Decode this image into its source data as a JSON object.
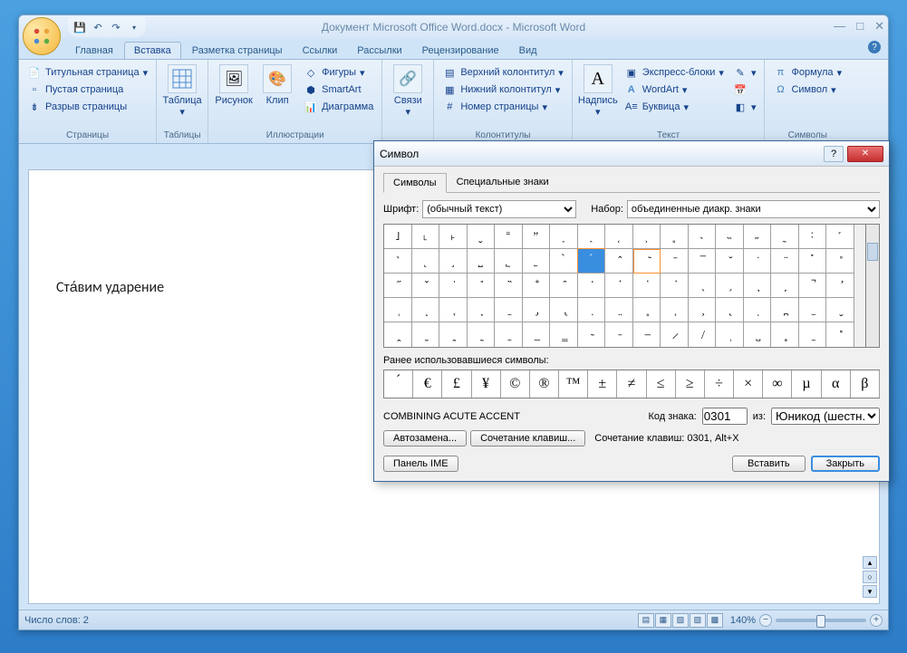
{
  "title": "Документ Microsoft Office Word.docx - Microsoft Word",
  "tabs": [
    "Главная",
    "Вставка",
    "Разметка страницы",
    "Ссылки",
    "Рассылки",
    "Рецензирование",
    "Вид"
  ],
  "active_tab": 1,
  "ribbon": {
    "groups": [
      {
        "label": "Страницы",
        "items": [
          "Титульная страница",
          "Пустая страница",
          "Разрыв страницы"
        ]
      },
      {
        "label": "Таблицы",
        "big": "Таблица"
      },
      {
        "label": "Иллюстрации",
        "bigs": [
          "Рисунок",
          "Клип"
        ],
        "items": [
          "Фигуры",
          "SmartArt",
          "Диаграмма"
        ]
      },
      {
        "label": "",
        "big": "Связи"
      },
      {
        "label": "Колонтитулы",
        "items": [
          "Верхний колонтитул",
          "Нижний колонтитул",
          "Номер страницы"
        ]
      },
      {
        "label": "Текст",
        "big": "Надпись",
        "items": [
          "Экспресс-блоки",
          "WordArt",
          "Буквица"
        ]
      },
      {
        "label": "Символы",
        "items": [
          "Формула",
          "Символ"
        ]
      }
    ]
  },
  "document_text": "Ста́вим ударение",
  "status": {
    "words": "Число слов: 2",
    "zoom": "140%"
  },
  "dialog": {
    "title": "Символ",
    "tabs": [
      "Символы",
      "Специальные знаки"
    ],
    "active_tab": 0,
    "font_label": "Шрифт:",
    "font_value": "(обычный текст)",
    "set_label": "Набор:",
    "set_value": "объединенные диакр. знаки",
    "grid": [
      [
        "˩",
        "˪",
        "˫",
        "ˬ",
        "˭",
        "ˮ",
        "˯",
        "˰",
        "˱",
        "˲",
        "˳",
        "˴",
        "˵",
        "˶",
        "˷",
        "˸",
        "˹"
      ],
      [
        "˺",
        "˻",
        "˼",
        "˽",
        "˾",
        "˿",
        "̀",
        "́",
        "̂",
        "̃",
        "̄",
        "̅",
        "̆",
        "̇",
        "̈",
        "̉",
        "̊"
      ],
      [
        "̋",
        "̌",
        "̍",
        "̎",
        "̏",
        "̐",
        "̑",
        "̒",
        "̓",
        "̔",
        "̕",
        "̖",
        "̗",
        "̘",
        "̙",
        "̚",
        "̛"
      ],
      [
        "̜",
        "̝",
        "̞",
        "̟",
        "̠",
        "̡",
        "̢",
        "̣",
        "̤",
        "̥",
        "̦",
        "̧",
        "̨",
        "̩",
        "̪",
        "̫",
        "̬"
      ],
      [
        "̭",
        "̮",
        "̯",
        "̰",
        "̱",
        "̲",
        "̳",
        "̴",
        "̵",
        "̶",
        "̷",
        "̸",
        "̹",
        "̺",
        "̻",
        "̼",
        "̽"
      ]
    ],
    "selected_row": 1,
    "selected_col": 7,
    "cursored_col": 9,
    "recent_label": "Ранее использовавшиеся символы:",
    "recent": [
      "́",
      "€",
      "£",
      "¥",
      "©",
      "®",
      "™",
      "±",
      "≠",
      "≤",
      "≥",
      "÷",
      "×",
      "∞",
      "µ",
      "α",
      "β"
    ],
    "char_name": "COMBINING ACUTE ACCENT",
    "code_label": "Код знака:",
    "code_value": "0301",
    "from_label": "из:",
    "from_value": "Юникод (шестн.)",
    "autocorrect_btn": "Автозамена...",
    "shortcut_btn": "Сочетание клавиш...",
    "shortcut_text": "Сочетание клавиш: 0301, Alt+X",
    "ime_btn": "Панель IME",
    "insert_btn": "Вставить",
    "close_btn": "Закрыть"
  }
}
